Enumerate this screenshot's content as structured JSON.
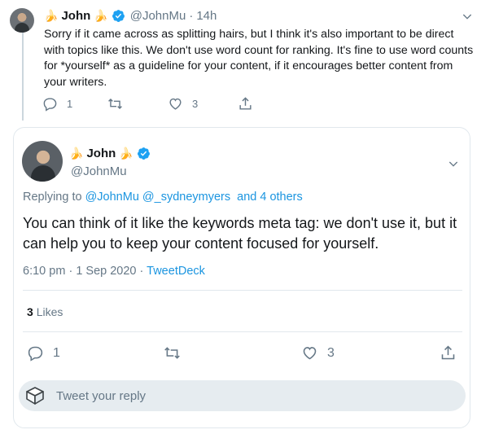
{
  "parent_tweet": {
    "prefix_emoji": "🍌",
    "name": "John",
    "suffix_emoji": "🍌",
    "handle": "@JohnMu",
    "separator": "·",
    "time": "14h",
    "text": "Sorry if it came across as splitting hairs, but I think it's also important to be direct with topics like this. We don't use word count for ranking. It's fine to use word counts for *yourself* as a guideline for your content, if it encourages better content from your writers.",
    "reply_count": "1",
    "like_count": "3"
  },
  "focused_tweet": {
    "prefix_emoji": "🍌",
    "name": "John",
    "suffix_emoji": "🍌",
    "handle": "@JohnMu",
    "replying_label": "Replying to",
    "replying_handles": "@JohnMu @_sydneymyers",
    "replying_others": "and 4 others",
    "text": "You can think of it like the keywords meta tag: we don't use it, but it can help you to keep your content focused for yourself.",
    "time": "6:10 pm",
    "separator1": "·",
    "date": "1 Sep 2020",
    "separator2": "·",
    "client": "TweetDeck",
    "likes_count": "3",
    "likes_label": "Likes",
    "reply_count": "1",
    "like_count": "3"
  },
  "reply_box": {
    "placeholder": "Tweet your reply"
  },
  "icons": {
    "verified": "verified-badge-icon",
    "chevron": "chevron-down-icon",
    "reply": "reply-icon",
    "retweet": "retweet-icon",
    "like": "heart-icon",
    "share": "share-icon"
  },
  "colors": {
    "accent": "#1b95e0",
    "verified": "#1da1f2",
    "muted": "#657786",
    "border": "#e1e8ed",
    "reply_box_bg": "#e6ecf0"
  }
}
